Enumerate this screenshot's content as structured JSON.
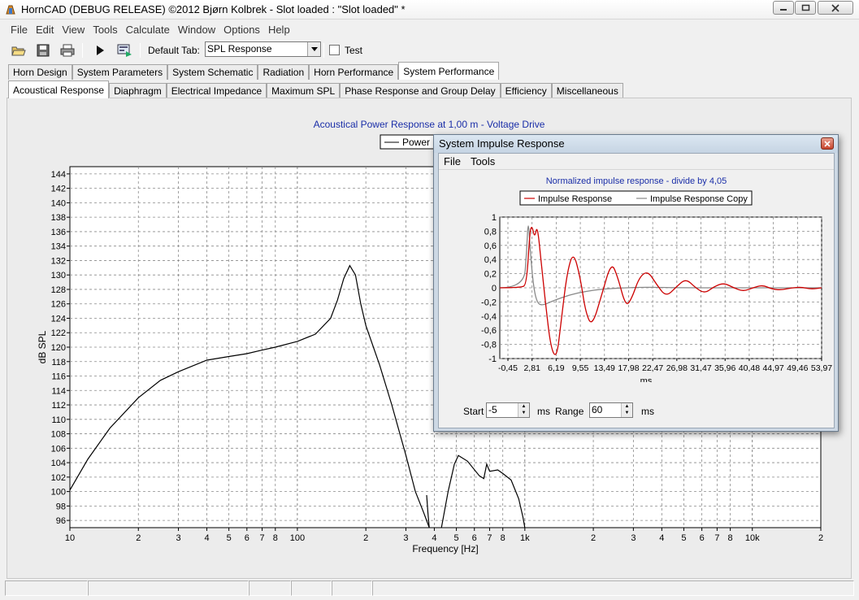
{
  "window": {
    "title": "HornCAD  (DEBUG RELEASE) ©2012 Bjørn Kolbrek - Slot loaded : \"Slot loaded\" *",
    "controls": [
      "minimize-icon",
      "maximize-icon",
      "close-icon"
    ]
  },
  "menu": [
    "File",
    "Edit",
    "View",
    "Tools",
    "Calculate",
    "Window",
    "Options",
    "Help"
  ],
  "toolbar": {
    "icons": [
      "open-folder-icon",
      "save-icon",
      "print-icon",
      "play-icon",
      "export-icon"
    ],
    "default_tab_label": "Default Tab:",
    "default_tab_value": "SPL Response",
    "test_label": "Test",
    "test_checked": false
  },
  "tabs_main": [
    "Horn Design",
    "System Parameters",
    "System Schematic",
    "Radiation",
    "Horn Performance",
    "System Performance"
  ],
  "tabs_main_active": 5,
  "tabs_sub": [
    "Acoustical Response",
    "Diaphragm",
    "Electrical Impedance",
    "Maximum SPL",
    "Phase Response and Group Delay",
    "Efficiency",
    "Miscellaneous"
  ],
  "tabs_sub_active": 0,
  "spl_chart": {
    "title": "Acoustical Power Response at 1,00 m - Voltage Drive",
    "legend_entry": "Power",
    "ylabel": "dB SPL",
    "xlabel": "Frequency [Hz]",
    "ytick_labels": [
      "144",
      "142",
      "140",
      "138",
      "136",
      "134",
      "132",
      "130",
      "128",
      "126",
      "124",
      "122",
      "120",
      "118",
      "116",
      "114",
      "112",
      "110",
      "108",
      "106",
      "104",
      "102",
      "100",
      "98",
      "96"
    ],
    "xtick_labels": [
      "10",
      "2",
      "3",
      "4",
      "5",
      "6",
      "7",
      "8",
      "100",
      "2",
      "3",
      "4",
      "5",
      "6",
      "7",
      "8",
      "1k",
      "2",
      "3",
      "4",
      "5",
      "6",
      "7",
      "8",
      "10k",
      "2"
    ]
  },
  "impulse_window": {
    "title": "System Impulse Response",
    "menu": [
      "File",
      "Tools"
    ],
    "chart_title": "Normalized impulse response - divide by 4,05",
    "legend": [
      "Impulse Response",
      "Impulse Response Copy"
    ],
    "xlabel": "ms",
    "ytick_labels": [
      "1",
      "0,8",
      "0,6",
      "0,4",
      "0,2",
      "0",
      "-0,2",
      "-0,4",
      "-0,6",
      "-0,8",
      "-1"
    ],
    "xtick_labels": [
      "-0,45",
      "2,81",
      "6,19",
      "9,55",
      "13,49",
      "17,98",
      "22,47",
      "26,98",
      "31,47",
      "35,96",
      "40,48",
      "44,97",
      "49,46",
      "53,97"
    ],
    "start_label": "Start",
    "start_value": "-5",
    "start_unit": "ms",
    "range_label": "Range",
    "range_value": "60",
    "range_unit": "ms"
  },
  "chart_data": [
    {
      "type": "line",
      "title": "Acoustical Power Response at 1,00 m - Voltage Drive",
      "xlabel": "Frequency [Hz]",
      "ylabel": "dB SPL",
      "xscale": "log",
      "xlim": [
        10,
        20000
      ],
      "ylim": [
        95,
        145
      ],
      "grid": true,
      "legend": "top-center",
      "series": [
        {
          "name": "Power",
          "color": "#000000",
          "segments": [
            [
              [
                10,
                100.2
              ],
              [
                12,
                104.5
              ],
              [
                15,
                108.8
              ],
              [
                20,
                113
              ],
              [
                25,
                115.4
              ],
              [
                30,
                116.6
              ],
              [
                40,
                118.2
              ],
              [
                50,
                118.7
              ],
              [
                60,
                119.1
              ],
              [
                70,
                119.6
              ],
              [
                80,
                120
              ],
              [
                100,
                120.8
              ],
              [
                120,
                121.8
              ],
              [
                140,
                124
              ],
              [
                150,
                126.5
              ],
              [
                160,
                129.5
              ],
              [
                170,
                131.3
              ],
              [
                180,
                130
              ],
              [
                190,
                126
              ],
              [
                200,
                123
              ],
              [
                230,
                117.5
              ],
              [
                260,
                112
              ],
              [
                300,
                105
              ],
              [
                330,
                100
              ],
              [
                360,
                97
              ],
              [
                380,
                95
              ]
            ],
            [
              [
                370,
                99.5
              ],
              [
                375,
                97
              ],
              [
                380,
                95
              ]
            ],
            [
              [
                430,
                95
              ],
              [
                460,
                100
              ],
              [
                490,
                103.8
              ],
              [
                510,
                105
              ],
              [
                560,
                104.2
              ],
              [
                630,
                102.2
              ],
              [
                660,
                101.8
              ],
              [
                680,
                103.8
              ],
              [
                700,
                102.8
              ],
              [
                760,
                103
              ],
              [
                800,
                102.5
              ],
              [
                870,
                101.6
              ],
              [
                940,
                99
              ],
              [
                980,
                96.5
              ],
              [
                1000,
                95
              ]
            ]
          ]
        }
      ]
    },
    {
      "type": "line",
      "title": "Normalized impulse response - divide by 4,05",
      "xlabel": "ms",
      "ylim": [
        -1,
        1
      ],
      "xlim": [
        -5,
        55
      ],
      "grid": true,
      "legend": "top-center",
      "series": [
        {
          "name": "Impulse Response",
          "color": "#cc0000",
          "points": [
            [
              -5,
              0
            ],
            [
              -1,
              0
            ],
            [
              0,
              0.05
            ],
            [
              0.6,
              0.8
            ],
            [
              1,
              0.88
            ],
            [
              1.5,
              0.7
            ],
            [
              2,
              0.9
            ],
            [
              2.8,
              0.3
            ],
            [
              3.5,
              -0.2
            ],
            [
              4.5,
              -0.85
            ],
            [
              5.6,
              -1
            ],
            [
              6.4,
              -0.5
            ],
            [
              7.5,
              0.2
            ],
            [
              8.7,
              0.52
            ],
            [
              10,
              0.15
            ],
            [
              11,
              -0.35
            ],
            [
              12.2,
              -0.55
            ],
            [
              14,
              -0.1
            ],
            [
              15.8,
              0.37
            ],
            [
              17,
              0.15
            ],
            [
              18.5,
              -0.27
            ],
            [
              19.6,
              -0.15
            ],
            [
              21,
              0.15
            ],
            [
              22.6,
              0.24
            ],
            [
              24.2,
              0.05
            ],
            [
              26,
              -0.13
            ],
            [
              28,
              0.02
            ],
            [
              29.7,
              0.13
            ],
            [
              31.5,
              0
            ],
            [
              33.2,
              -0.08
            ],
            [
              35,
              0.02
            ],
            [
              36.8,
              0.07
            ],
            [
              38.6,
              0
            ],
            [
              40.4,
              -0.05
            ],
            [
              42.2,
              0
            ],
            [
              44,
              0.04
            ],
            [
              45.8,
              -0.02
            ],
            [
              47.6,
              -0.03
            ],
            [
              49.4,
              0
            ],
            [
              51.2,
              0.01
            ],
            [
              53,
              -0.02
            ],
            [
              55,
              0
            ]
          ]
        },
        {
          "name": "Impulse Response Copy",
          "color": "#888888",
          "points": [
            [
              -5,
              0
            ],
            [
              -0.5,
              0
            ],
            [
              0,
              0.5
            ],
            [
              0.3,
              1
            ],
            [
              0.7,
              0.5
            ],
            [
              1.3,
              0
            ],
            [
              2,
              -0.22
            ],
            [
              3,
              -0.25
            ],
            [
              5,
              -0.18
            ],
            [
              8,
              -0.1
            ],
            [
              11,
              -0.05
            ],
            [
              14,
              -0.02
            ],
            [
              18,
              0
            ],
            [
              22,
              0.01
            ],
            [
              30,
              0
            ],
            [
              55,
              0
            ]
          ]
        }
      ]
    }
  ],
  "colors": {
    "window_bg": "#f0f0f0",
    "chart_title": "#1a2ea8",
    "impulse_red": "#cc0000",
    "impulse_gray": "#888888",
    "popup_frame": "#cdd8e4"
  }
}
